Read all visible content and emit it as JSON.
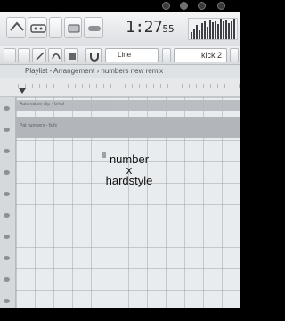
{
  "toolbar": {
    "clock": {
      "main": "1:27",
      "sub": "55"
    },
    "snap": {
      "value": "Line"
    },
    "pattern": {
      "value": "kick 2"
    }
  },
  "breadcrumb": {
    "text": "Playlist - Arrangement › numbers new remix"
  },
  "playlist": {
    "clips": [
      {
        "label": "Automation clip · fx/vol"
      },
      {
        "label": "Pat numbers - fx/fx"
      }
    ]
  },
  "caption": {
    "line1": "number",
    "line2": "x",
    "line3": "hardstyle"
  },
  "colors": {
    "accent": "#3e4247",
    "grid_bg": "#e9ecee"
  },
  "icons": [
    "undo-icon",
    "pencil-icon",
    "tape-icon",
    "pattern-icon",
    "playlist-icon",
    "draw-icon",
    "paint-icon",
    "stamp-icon",
    "magnet-icon"
  ]
}
